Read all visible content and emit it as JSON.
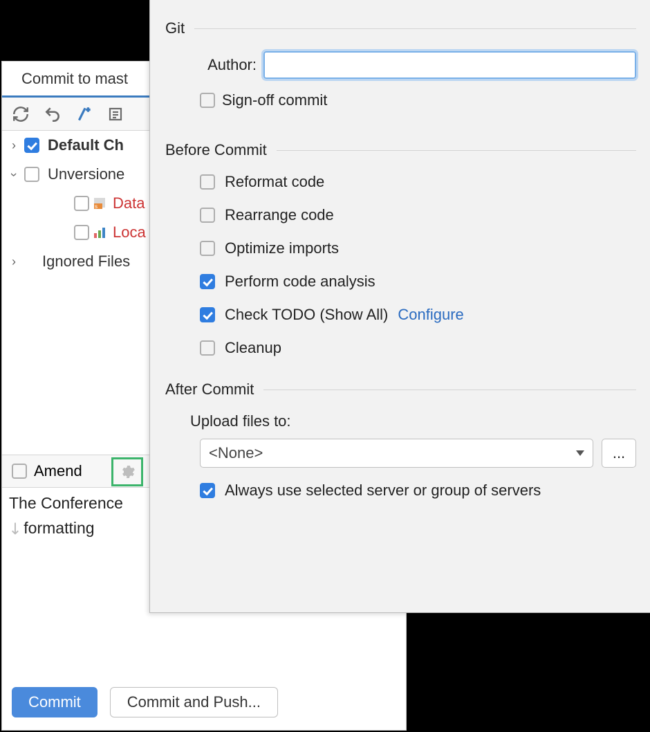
{
  "panel": {
    "tab_title": "Commit to mast",
    "tree": {
      "default_changelist": "Default Ch",
      "unversioned": "Unversione",
      "file_data": "Data",
      "file_loca": "Loca",
      "ignored": "Ignored Files"
    },
    "amend": "Amend",
    "message_line1": "The Conference",
    "message_line2": "formatting ",
    "commit_btn": "Commit",
    "commit_push_btn": "Commit and Push..."
  },
  "popover": {
    "git_section": "Git",
    "author_label": "Author:",
    "author_value": "",
    "signoff": "Sign-off commit",
    "before_section": "Before Commit",
    "opts": {
      "reformat": "Reformat code",
      "rearrange": "Rearrange code",
      "optimize": "Optimize imports",
      "analysis": "Perform code analysis",
      "todo": "Check TODO (Show All)",
      "todo_link": "Configure",
      "cleanup": "Cleanup"
    },
    "after_section": "After Commit",
    "upload_label": "Upload files to:",
    "upload_value": "<None>",
    "more": "...",
    "always": "Always use selected server or group of servers"
  }
}
